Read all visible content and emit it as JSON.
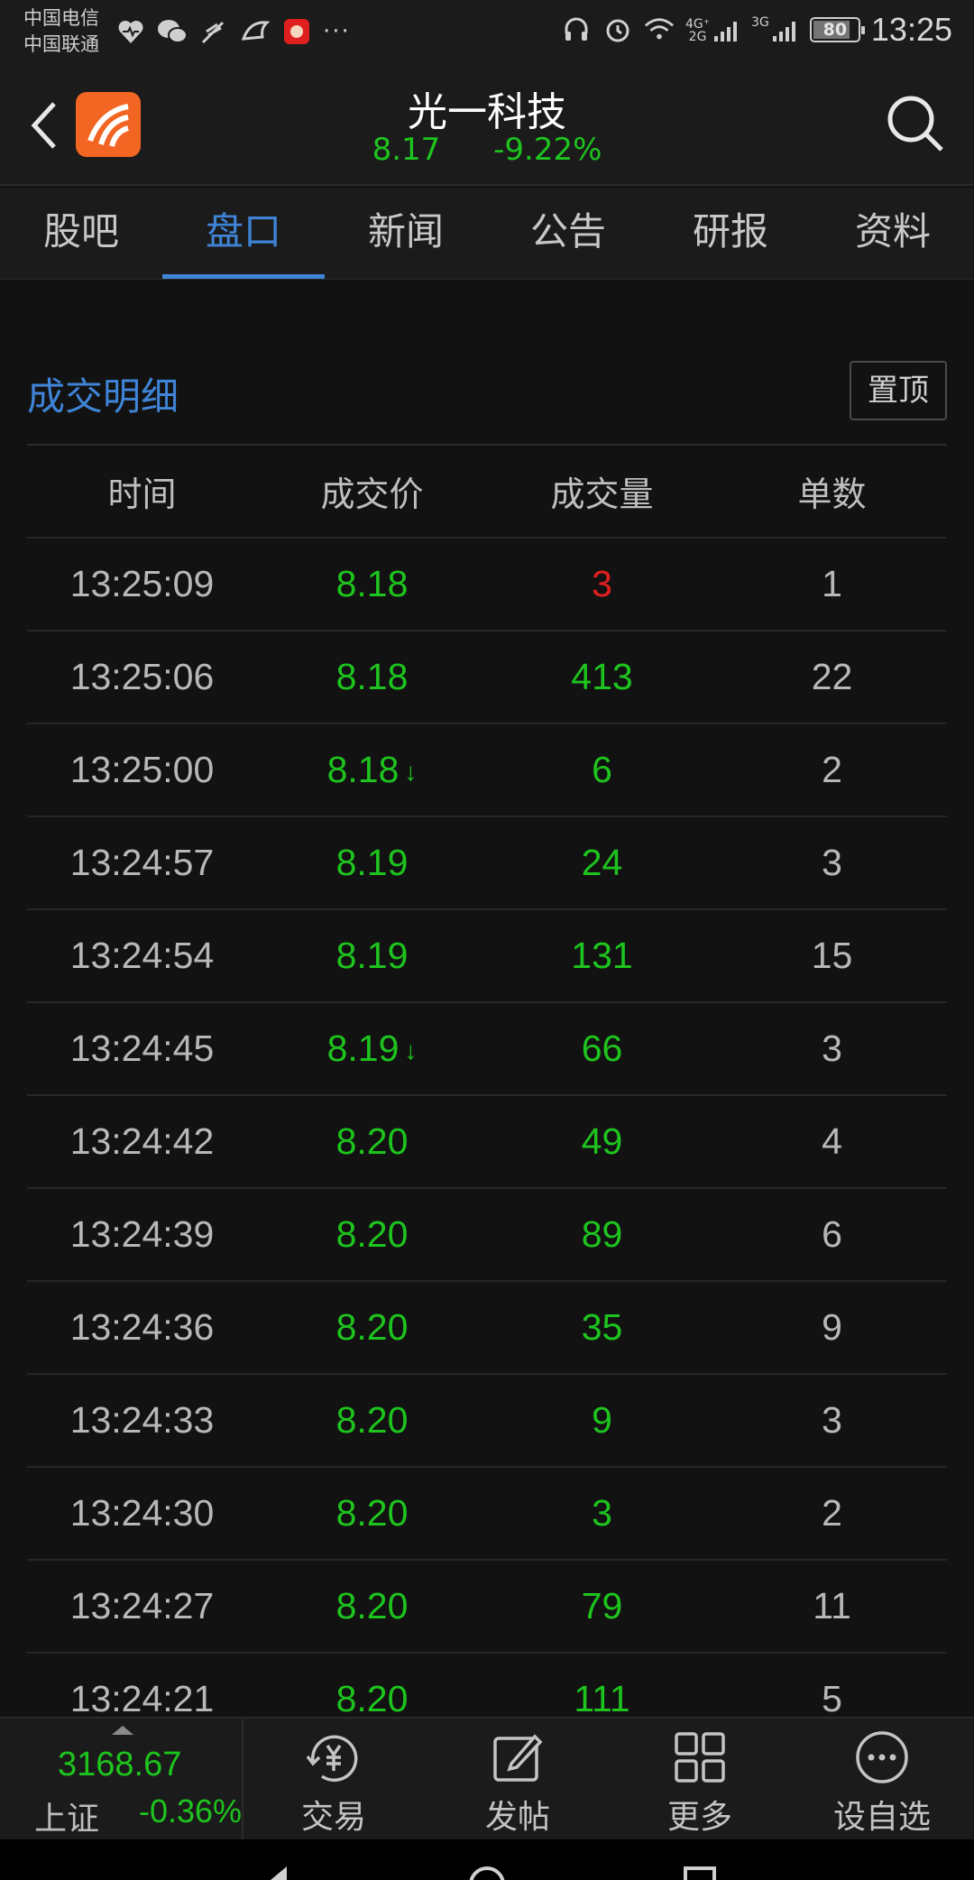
{
  "status_bar": {
    "carriers": [
      "中国电信",
      "中国联通"
    ],
    "network_upper": "4G⁺",
    "network_lower": "2G",
    "network_3g": "3G",
    "battery": "80",
    "time": "13:25"
  },
  "header": {
    "stock_name": "光一科技",
    "price": "8.17",
    "change_pct": "-9.22%"
  },
  "tabs": [
    "股吧",
    "盘口",
    "新闻",
    "公告",
    "研报",
    "资料"
  ],
  "active_tab": "盘口",
  "section": {
    "title": "成交明细",
    "pin_label": "置顶"
  },
  "table": {
    "columns": [
      "时间",
      "成交价",
      "成交量",
      "单数"
    ],
    "rows": [
      {
        "time": "13:25:09",
        "price": "8.18",
        "volume": "3",
        "count": "1"
      },
      {
        "time": "13:25:06",
        "price": "8.18",
        "volume": "413",
        "count": "22"
      },
      {
        "time": "13:25:00",
        "price": "8.18",
        "arrow": "↓",
        "volume": "6",
        "count": "2"
      },
      {
        "time": "13:24:57",
        "price": "8.19",
        "volume": "24",
        "count": "3"
      },
      {
        "time": "13:24:54",
        "price": "8.19",
        "volume": "131",
        "count": "15"
      },
      {
        "time": "13:24:45",
        "price": "8.19",
        "arrow": "↓",
        "volume": "66",
        "count": "3"
      },
      {
        "time": "13:24:42",
        "price": "8.20",
        "volume": "49",
        "count": "4"
      },
      {
        "time": "13:24:39",
        "price": "8.20",
        "volume": "89",
        "count": "6"
      },
      {
        "time": "13:24:36",
        "price": "8.20",
        "volume": "35",
        "count": "9"
      },
      {
        "time": "13:24:33",
        "price": "8.20",
        "volume": "9",
        "count": "3"
      },
      {
        "time": "13:24:30",
        "price": "8.20",
        "volume": "3",
        "count": "2"
      },
      {
        "time": "13:24:27",
        "price": "8.20",
        "volume": "79",
        "count": "11"
      },
      {
        "time": "13:24:21",
        "price": "8.20",
        "volume": "111",
        "count": "5"
      }
    ]
  },
  "bottom_bar": {
    "index_value": "3168.67",
    "index_name": "上证",
    "index_change": "-0.36%",
    "nav": [
      {
        "label": "交易",
        "icon": "yuan-cycle-icon"
      },
      {
        "label": "发帖",
        "icon": "edit-icon"
      },
      {
        "label": "更多",
        "icon": "grid-icon"
      },
      {
        "label": "设自选",
        "icon": "more-circle-icon"
      }
    ]
  },
  "colors": {
    "background": "#121212",
    "accent_blue": "#3f84d6",
    "down_green": "#1ec41e",
    "up_red": "#e0201e",
    "logo_orange": "#f26522"
  }
}
